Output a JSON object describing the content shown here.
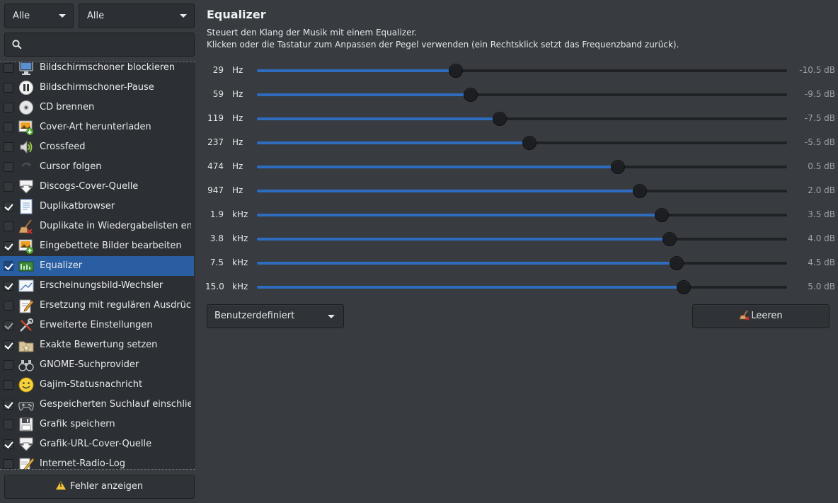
{
  "filters": {
    "left_combo": "Alle",
    "right_combo": "Alle"
  },
  "search": {
    "placeholder": ""
  },
  "plugins": [
    {
      "label": "Bildschirmschoner blockieren",
      "checked": false,
      "icon": "monitor-icon"
    },
    {
      "label": "Bildschirmschoner-Pause",
      "checked": false,
      "icon": "pause-icon"
    },
    {
      "label": "CD brennen",
      "checked": false,
      "icon": "cd-icon"
    },
    {
      "label": "Cover-Art herunterladen",
      "checked": false,
      "icon": "image-download-icon"
    },
    {
      "label": "Crossfeed",
      "checked": false,
      "icon": "speaker-icon"
    },
    {
      "label": "Cursor folgen",
      "checked": false,
      "icon": "cursor-arrow-icon"
    },
    {
      "label": "Discogs-Cover-Quelle",
      "checked": false,
      "icon": "download-arrow-icon"
    },
    {
      "label": "Duplikatbrowser",
      "checked": true,
      "icon": "document-icon"
    },
    {
      "label": "Duplikate in Wiedergabelisten entf...",
      "checked": false,
      "icon": "broom-icon"
    },
    {
      "label": "Eingebettete Bilder bearbeiten",
      "checked": true,
      "icon": "image-edit-icon"
    },
    {
      "label": "Equalizer",
      "checked": true,
      "icon": "equalizer-icon",
      "selected": true
    },
    {
      "label": "Erscheinungsbild-Wechsler",
      "checked": true,
      "icon": "picture-icon"
    },
    {
      "label": "Ersetzung mit regulären Ausdrücken",
      "checked": false,
      "icon": "edit-icon"
    },
    {
      "label": "Erweiterte Einstellungen",
      "checked": true,
      "dim": true,
      "icon": "tools-icon"
    },
    {
      "label": "Exakte Bewertung setzen",
      "checked": true,
      "icon": "folder-star-icon"
    },
    {
      "label": "GNOME-Suchprovider",
      "checked": false,
      "icon": "binoculars-icon"
    },
    {
      "label": "Gajim-Statusnachricht",
      "checked": false,
      "icon": "smiley-icon"
    },
    {
      "label": "Gespeicherten Suchlauf einschließ...",
      "checked": true,
      "icon": "gamepad-icon"
    },
    {
      "label": "Grafik speichern",
      "checked": false,
      "icon": "floppy-icon"
    },
    {
      "label": "Grafik-URL-Cover-Quelle",
      "checked": true,
      "icon": "download-arrow-icon"
    },
    {
      "label": "Internet-Radio-Log",
      "checked": false,
      "icon": "pencil-icon"
    }
  ],
  "error_button": {
    "label": "Fehler anzeigen"
  },
  "equalizer": {
    "title": "Equalizer",
    "description_line1": "Steuert den Klang der Musik mit einem Equalizer.",
    "description_line2": "Klicken oder die Tastatur zum Anpassen der Pegel verwenden (ein Rechtsklick setzt das Frequenzband zurück).",
    "range_db": [
      -24,
      12
    ],
    "bands": [
      {
        "freq": "29",
        "unit": "Hz",
        "gain": -10.5,
        "gain_label": "-10.5 dB"
      },
      {
        "freq": "59",
        "unit": "Hz",
        "gain": -9.5,
        "gain_label": "-9.5 dB"
      },
      {
        "freq": "119",
        "unit": "Hz",
        "gain": -7.5,
        "gain_label": "-7.5 dB"
      },
      {
        "freq": "237",
        "unit": "Hz",
        "gain": -5.5,
        "gain_label": "-5.5 dB"
      },
      {
        "freq": "474",
        "unit": "Hz",
        "gain": 0.5,
        "gain_label": "0.5 dB"
      },
      {
        "freq": "947",
        "unit": "Hz",
        "gain": 2.0,
        "gain_label": "2.0 dB"
      },
      {
        "freq": "1.9",
        "unit": "kHz",
        "gain": 3.5,
        "gain_label": "3.5 dB"
      },
      {
        "freq": "3.8",
        "unit": "kHz",
        "gain": 4.0,
        "gain_label": "4.0 dB"
      },
      {
        "freq": "7.5",
        "unit": "kHz",
        "gain": 4.5,
        "gain_label": "4.5 dB"
      },
      {
        "freq": "15.0",
        "unit": "kHz",
        "gain": 5.0,
        "gain_label": "5.0 dB"
      }
    ],
    "preset": "Benutzerdefiniert",
    "clear_label": "Leeren"
  },
  "colors": {
    "accent": "#2e6cc0",
    "selection": "#2a5ea3",
    "background": "#383c40",
    "warning": "#f3c13a"
  }
}
